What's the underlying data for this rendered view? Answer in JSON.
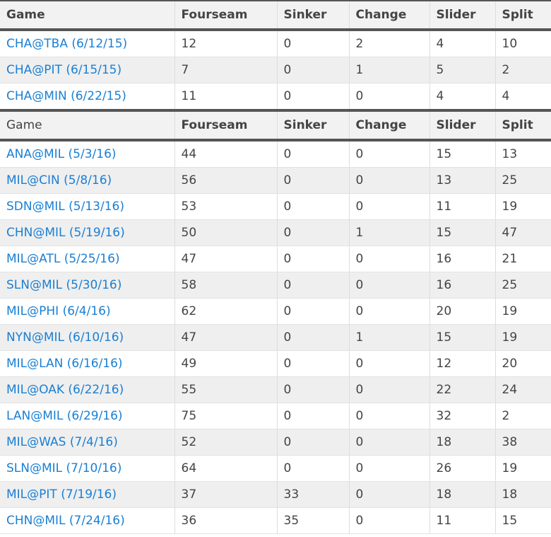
{
  "colors": {
    "link": "#1a7fd4",
    "change": "#1515d6",
    "slider": "#e01212",
    "split": "#8a2be2"
  },
  "headers": {
    "game": "Game",
    "fourseam": "Fourseam",
    "sinker": "Sinker",
    "change": "Change",
    "slider": "Slider",
    "split": "Split"
  },
  "section1": [
    {
      "game": "CHA@TBA (6/12/15)",
      "fourseam": "12",
      "sinker": "0",
      "change": "2",
      "slider": "4",
      "split": "10"
    },
    {
      "game": "CHA@PIT (6/15/15)",
      "fourseam": "7",
      "sinker": "0",
      "change": "1",
      "slider": "5",
      "split": "2"
    },
    {
      "game": "CHA@MIN (6/22/15)",
      "fourseam": "11",
      "sinker": "0",
      "change": "0",
      "slider": "4",
      "split": "4"
    }
  ],
  "section2": [
    {
      "game": "ANA@MIL (5/3/16)",
      "fourseam": "44",
      "sinker": "0",
      "change": "0",
      "slider": "15",
      "split": "13"
    },
    {
      "game": "MIL@CIN (5/8/16)",
      "fourseam": "56",
      "sinker": "0",
      "change": "0",
      "slider": "13",
      "split": "25"
    },
    {
      "game": "SDN@MIL (5/13/16)",
      "fourseam": "53",
      "sinker": "0",
      "change": "0",
      "slider": "11",
      "split": "19"
    },
    {
      "game": "CHN@MIL (5/19/16)",
      "fourseam": "50",
      "sinker": "0",
      "change": "1",
      "slider": "15",
      "split": "47"
    },
    {
      "game": "MIL@ATL (5/25/16)",
      "fourseam": "47",
      "sinker": "0",
      "change": "0",
      "slider": "16",
      "split": "21"
    },
    {
      "game": "SLN@MIL (5/30/16)",
      "fourseam": "58",
      "sinker": "0",
      "change": "0",
      "slider": "16",
      "split": "25"
    },
    {
      "game": "MIL@PHI (6/4/16)",
      "fourseam": "62",
      "sinker": "0",
      "change": "0",
      "slider": "20",
      "split": "19"
    },
    {
      "game": "NYN@MIL (6/10/16)",
      "fourseam": "47",
      "sinker": "0",
      "change": "1",
      "slider": "15",
      "split": "19"
    },
    {
      "game": "MIL@LAN (6/16/16)",
      "fourseam": "49",
      "sinker": "0",
      "change": "0",
      "slider": "12",
      "split": "20"
    },
    {
      "game": "MIL@OAK (6/22/16)",
      "fourseam": "55",
      "sinker": "0",
      "change": "0",
      "slider": "22",
      "split": "24"
    },
    {
      "game": "LAN@MIL (6/29/16)",
      "fourseam": "75",
      "sinker": "0",
      "change": "0",
      "slider": "32",
      "split": "2"
    },
    {
      "game": "MIL@WAS (7/4/16)",
      "fourseam": "52",
      "sinker": "0",
      "change": "0",
      "slider": "18",
      "split": "38"
    },
    {
      "game": "SLN@MIL (7/10/16)",
      "fourseam": "64",
      "sinker": "0",
      "change": "0",
      "slider": "26",
      "split": "19"
    },
    {
      "game": "MIL@PIT (7/19/16)",
      "fourseam": "37",
      "sinker": "33",
      "change": "0",
      "slider": "18",
      "split": "18"
    },
    {
      "game": "CHN@MIL (7/24/16)",
      "fourseam": "36",
      "sinker": "35",
      "change": "0",
      "slider": "11",
      "split": "15"
    }
  ]
}
